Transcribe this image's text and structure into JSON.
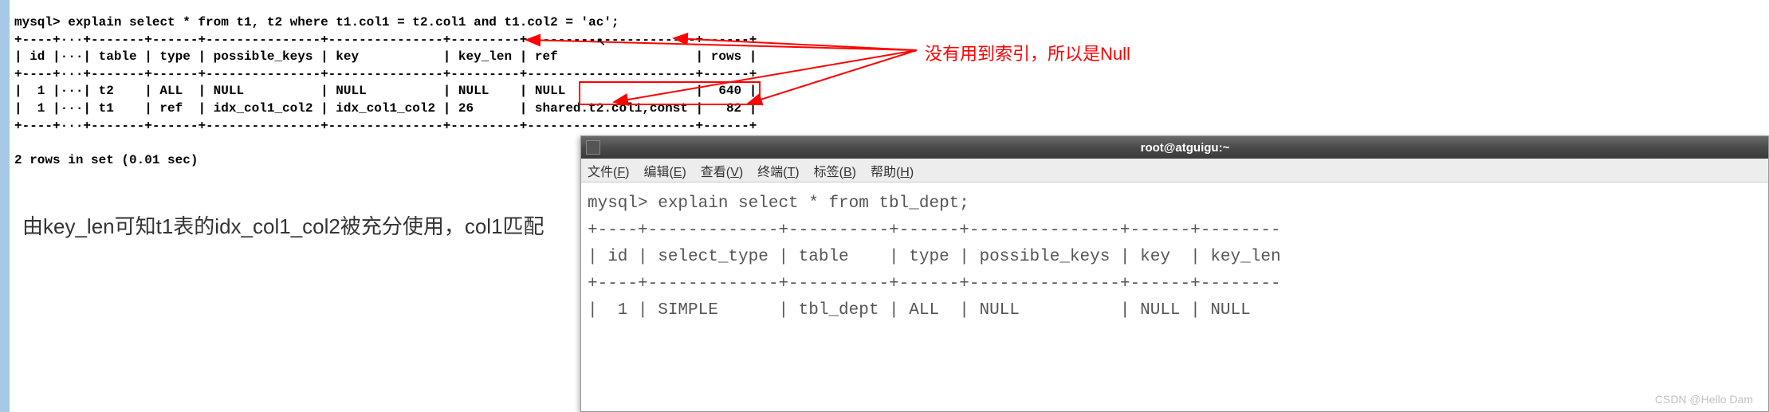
{
  "sql_prompt": "mysql> ",
  "sql_query": "explain select * from t1, t2 where t1.col1 = t2.col1 and t1.col2 = 'ac';",
  "table_border_top": "+----+···+-------+------+---------------+---------------+---------+----------------------+------+",
  "table_header": "| id |···| table | type | possible_keys | key           | key_len | ref                  | rows |",
  "table_border_mid": "+----+···+-------+------+---------------+---------------+---------+----------------------+------+",
  "table_row1": "|  1 |···| t2    | ALL  | NULL          | NULL          | NULL    | NULL                 |  640 |",
  "table_row2": "|  1 |···| t1    | ref  | idx_col1_col2 | idx_col1_col2 | 26      | shared.t2.col1,const |   82 |",
  "table_border_bot": "+----+···+-------+------+---------------+---------------+---------+----------------------+------+",
  "result_summary": "2 rows in set (0.01 sec)",
  "chinese_explain": "由key_len可知t1表的idx_col1_col2被充分使用，col1匹配",
  "annotation_text": "没有用到索引，所以是Null",
  "terminal": {
    "title": "root@atguigu:~",
    "menubar": [
      "文件(F)",
      "编辑(E)",
      "查看(V)",
      "终端(T)",
      "标签(B)",
      "帮助(H)"
    ],
    "line1": "mysql> explain select * from tbl_dept;",
    "line2": "+----+-------------+----------+------+---------------+------+--------",
    "line3": "| id | select_type | table    | type | possible_keys | key  | key_len",
    "line4": "+----+-------------+----------+------+---------------+------+--------",
    "line5": "|  1 | SIMPLE      | tbl_dept | ALL  | NULL          | NULL | NULL"
  },
  "watermark": "CSDN @Hello Dam"
}
